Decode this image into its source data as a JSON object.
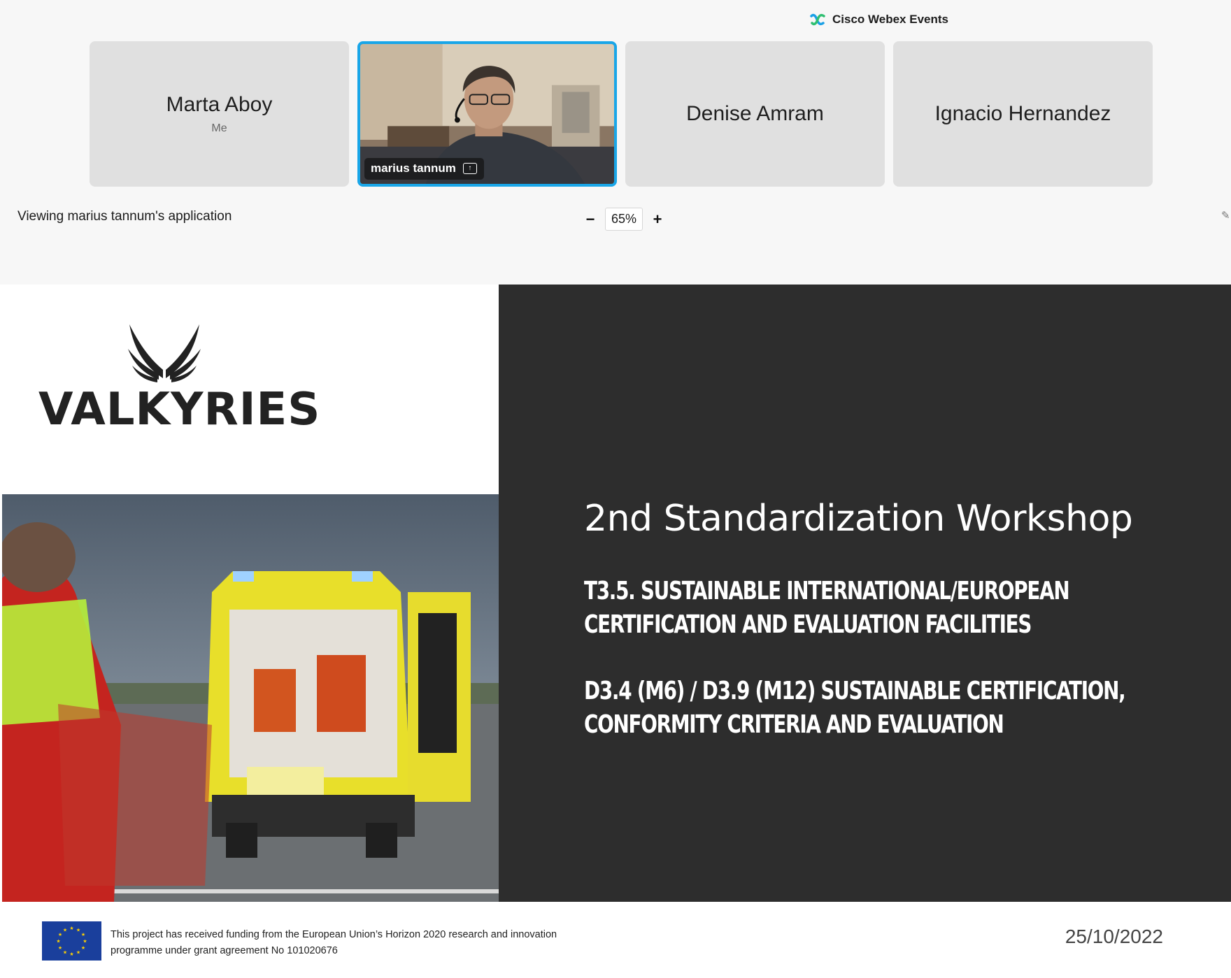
{
  "app": {
    "title": "Cisco Webex Events"
  },
  "participants": [
    {
      "name": "Marta Aboy",
      "sub": "Me"
    },
    {
      "name": "marius tannum",
      "sub": ""
    },
    {
      "name": "Denise Amram",
      "sub": ""
    },
    {
      "name": "Ignacio Hernandez",
      "sub": ""
    }
  ],
  "viewing": {
    "text": "Viewing marius tannum's application"
  },
  "zoom": {
    "minus": "−",
    "value": "65%",
    "plus": "+"
  },
  "slide": {
    "logo_text": "VALKYRIES",
    "title": "2nd Standardization Workshop",
    "heading1": "T3.5. SUSTAINABLE INTERNATIONAL/EUROPEAN CERTIFICATION AND EVALUATION FACILITIES",
    "heading2": "D3.4 (M6) / D3.9 (M12)  SUSTAINABLE CERTIFICATION, CONFORMITY CRITERIA AND EVALUATION",
    "funding_line1": "This project has received funding from the European Union’s Horizon 2020 research and innovation",
    "funding_line2": "programme under grant agreement No 101020676",
    "date": "25/10/2022"
  },
  "colors": {
    "active_border": "#19a6e8",
    "slide_dark": "#2d2d2d",
    "eu_blue": "#1a3f9c",
    "eu_star": "#ffd200"
  }
}
